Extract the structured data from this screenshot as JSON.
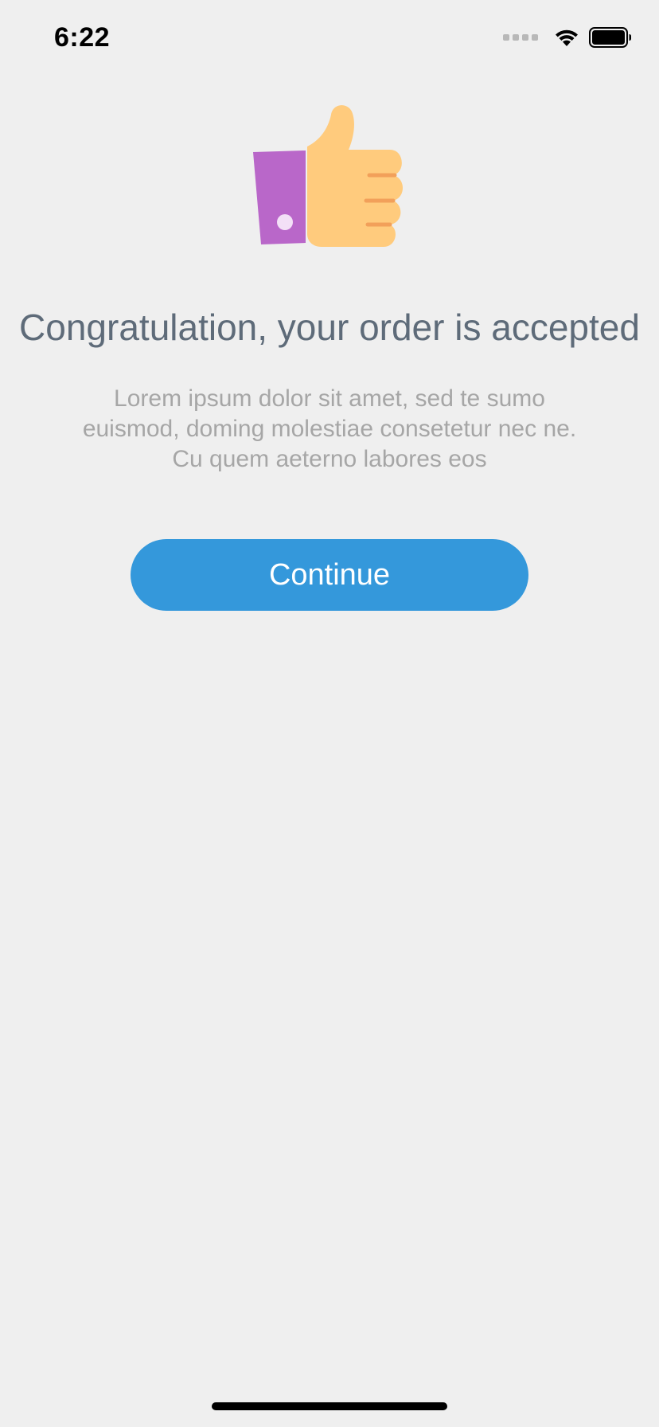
{
  "status_bar": {
    "time": "6:22",
    "signal_icon": "signal-dots-icon",
    "wifi_icon": "wifi-icon",
    "battery_icon": "battery-icon"
  },
  "hero": {
    "icon": "thumbs-up-icon",
    "colors": {
      "sleeve": "#b967c9",
      "hand": "#ffcb7d",
      "finger_lines": "#f2a05a",
      "cuff_button": "#f3e0f7"
    }
  },
  "headline": "Congratulation, your order is accepted",
  "description": "Lorem ipsum dolor sit amet, sed te sumo euismod, doming molestiae consetetur nec ne. Cu quem aeterno labores eos",
  "actions": {
    "continue_label": "Continue"
  },
  "colors": {
    "background": "#efefef",
    "accent": "#3498db",
    "headline": "#5e6b79",
    "body_text": "#a6a6a6"
  }
}
